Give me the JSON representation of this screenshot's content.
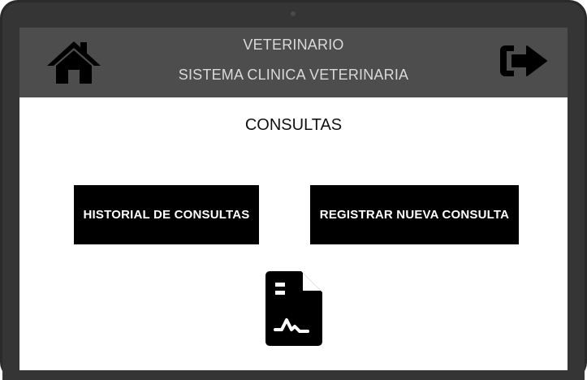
{
  "header": {
    "app_name": "VETERINARIO",
    "system_name": "SISTEMA CLINICA VETERINARIA",
    "home_icon": "home-icon",
    "logout_icon": "sign-out-icon"
  },
  "main": {
    "section_title": "CONSULTAS",
    "buttons": {
      "historial": "HISTORIAL DE CONSULTAS",
      "registrar": "REGISTRAR NUEVA CONSULTA"
    },
    "illustration_icon": "document-signature-icon"
  },
  "colors": {
    "header_bg": "#4d4d4d",
    "header_text": "#d9d9d9",
    "button_bg": "#000000",
    "button_text": "#ffffff",
    "device_frame": "#2a2a2a"
  }
}
